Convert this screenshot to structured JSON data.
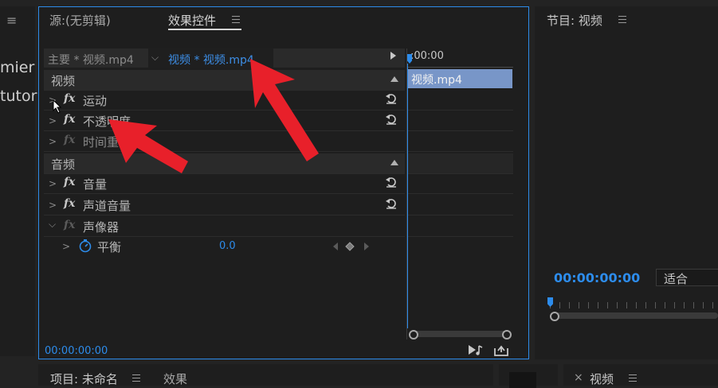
{
  "left_panel": {
    "menu_glyph": "≡",
    "cut_text_1": "mier",
    "cut_text_2": "tutor"
  },
  "effects_panel": {
    "tabs": [
      {
        "label": "源:(无剪辑)",
        "active": false
      },
      {
        "label": "效果控件",
        "active": true
      }
    ],
    "menu_glyph": "≡",
    "source_label": "主要 * 视频.mp4",
    "clip_label": "视频 * 视频.mp4",
    "video_section": "视频",
    "audio_section": "音频",
    "effects_video": [
      {
        "label": "运动",
        "has_reset": true
      },
      {
        "label": "不透明度",
        "has_reset": true
      },
      {
        "label": "时间重映射",
        "has_reset": false
      }
    ],
    "effects_audio": [
      {
        "label": "音量",
        "has_reset": true
      },
      {
        "label": "声道音量",
        "has_reset": true
      },
      {
        "label": "声像器",
        "has_reset": false
      }
    ],
    "param": {
      "label": "平衡",
      "value": "0.0"
    },
    "timeline": {
      "time_start": ":00:00",
      "clip_name": "视频.mp4"
    },
    "timecode": "00:00:00:00"
  },
  "program_panel": {
    "title": "节目: 视频",
    "menu_glyph": "≡",
    "timecode": "00:00:00:00",
    "fit_option": "适合"
  },
  "bottom": {
    "project_tab": "项目: 未命名",
    "effects_tab": "效果",
    "seq_close": "×",
    "seq_tab": "视频",
    "menu_glyph": "≡"
  },
  "colors": {
    "accent": "#2d8ceb",
    "clip": "#7896c8",
    "arrow": "#e8202a",
    "panel_border": "#2d8ceb"
  }
}
